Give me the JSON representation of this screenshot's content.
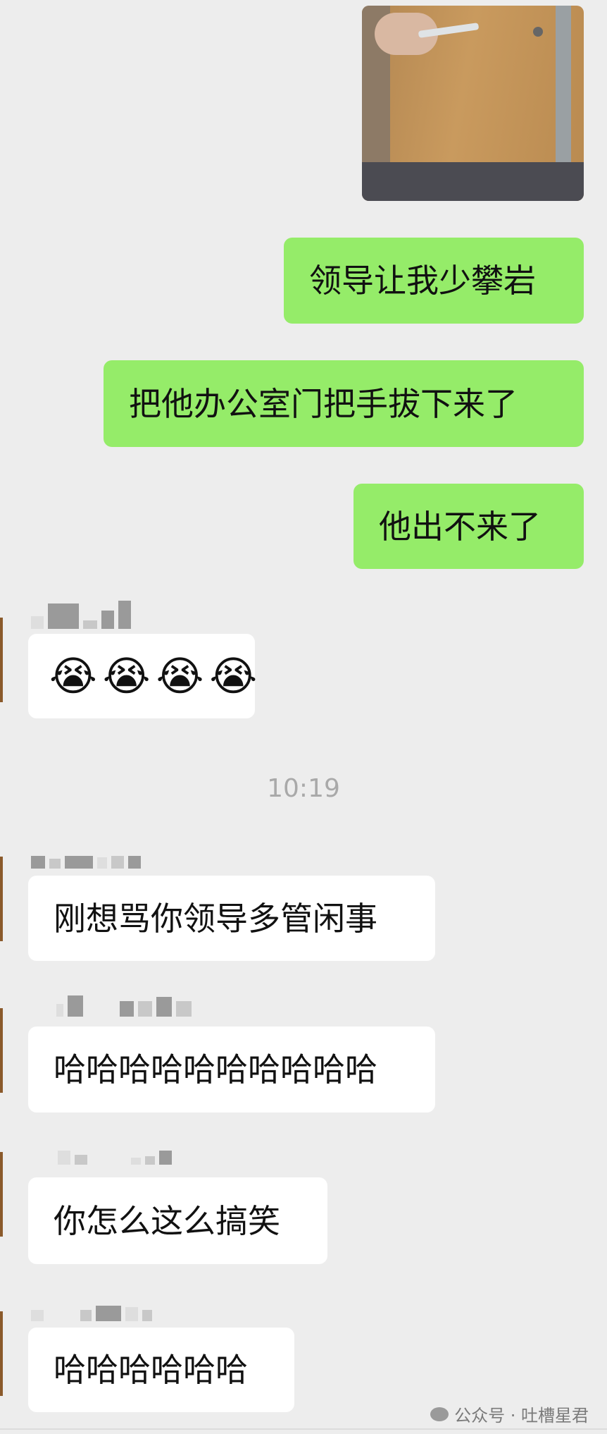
{
  "messages": {
    "m1": "领导让我少攀岩",
    "m2": "把他办公室门把手拔下来了",
    "m3": "他出不来了",
    "m4": "😭😭😭😭",
    "m5": "刚想骂你领导多管闲事",
    "m6": "哈哈哈哈哈哈哈哈哈哈",
    "m7": "你怎么这么搞笑",
    "m8": "哈哈哈哈哈哈"
  },
  "emojis": [
    "😭",
    "😭",
    "😭",
    "😭"
  ],
  "timestamp": "10:19",
  "watermark": {
    "text": "公众号 · 吐槽星君",
    "icon": "wechat-official-account-icon"
  },
  "colors": {
    "sent_bubble": "#95ec69",
    "received_bubble": "#ffffff",
    "background": "#ededed"
  }
}
